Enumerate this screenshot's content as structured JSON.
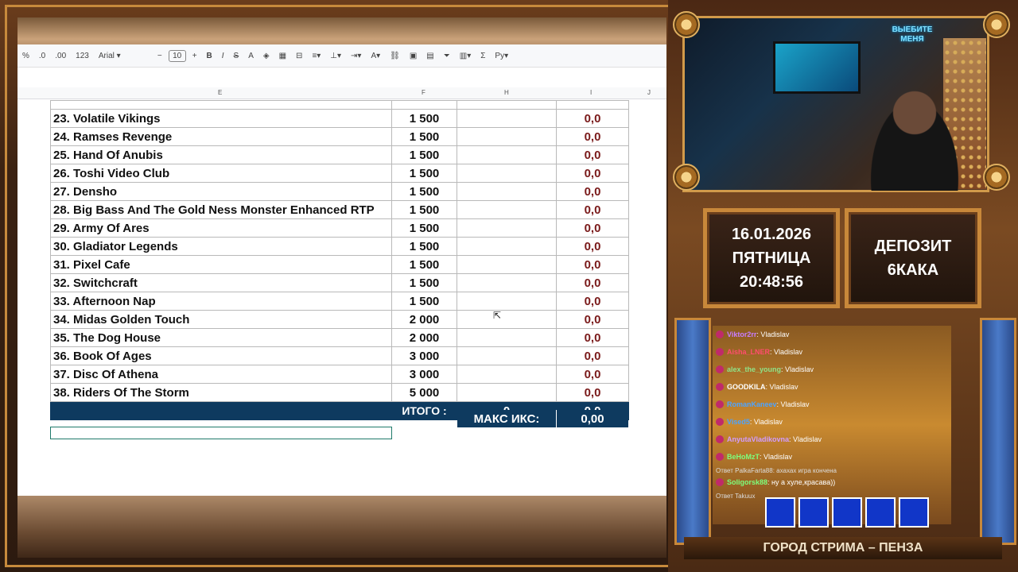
{
  "toolbar": {
    "items": [
      "%",
      ".0",
      ".00",
      "123"
    ],
    "font": "Arial",
    "font_size": "10",
    "minus": "−",
    "plus": "+",
    "bold": "B",
    "italic": "I",
    "strike": "S",
    "text_color": "A",
    "sigma": "Σ",
    "input_tools": "Рy"
  },
  "columns": {
    "e": "E",
    "f": "F",
    "h": "H",
    "i": "I",
    "j": "J"
  },
  "rows": [
    {
      "name": "23. Volatile Vikings",
      "bet": "1 500",
      "result": "0,0"
    },
    {
      "name": "24. Ramses Revenge",
      "bet": "1 500",
      "result": "0,0"
    },
    {
      "name": "25. Hand Of Anubis",
      "bet": "1 500",
      "result": "0,0"
    },
    {
      "name": "26. Toshi Video Club",
      "bet": "1 500",
      "result": "0,0"
    },
    {
      "name": "27. Densho",
      "bet": "1 500",
      "result": "0,0"
    },
    {
      "name": "28. Big Bass And The Gold Ness Monster Enhanced RTP",
      "bet": "1 500",
      "result": "0,0"
    },
    {
      "name": "29. Army Of Ares",
      "bet": "1 500",
      "result": "0,0"
    },
    {
      "name": "30. Gladiator Legends",
      "bet": "1 500",
      "result": "0,0"
    },
    {
      "name": "31. Pixel Cafe",
      "bet": "1 500",
      "result": "0,0"
    },
    {
      "name": "32. Switchcraft",
      "bet": "1 500",
      "result": "0,0"
    },
    {
      "name": "33. Afternoon Nap",
      "bet": "1 500",
      "result": "0,0"
    },
    {
      "name": "34. Midas Golden Touch",
      "bet": "2 000",
      "result": "0,0"
    },
    {
      "name": "35. The Dog House",
      "bet": "2 000",
      "result": "0,0"
    },
    {
      "name": "36. Book Of Ages",
      "bet": "3 000",
      "result": "0,0"
    },
    {
      "name": "37. Disc Of Athena",
      "bet": "3 000",
      "result": "0,0"
    },
    {
      "name": "38. Riders Of The Storm",
      "bet": "5 000",
      "result": "0,0"
    }
  ],
  "total": {
    "label": "ИТОГО :",
    "sum": "0",
    "result": "0,0"
  },
  "max_x": {
    "label": "МАКС ИКС:",
    "value": "0,00"
  },
  "stream": {
    "cam_badge": "ВЫЕБИТЕ МЕНЯ",
    "date": "16.01.2026",
    "weekday": "ПЯТНИЦА",
    "time": "20:48:56",
    "deposit_label": "ДЕПОЗИТ",
    "deposit_value": "6КАКА",
    "footer": "ГОРОД СТРИМА – ПЕНЗА"
  },
  "chat": [
    {
      "user": "Viktor2rr",
      "msg": ": Vladislav",
      "color": "#c77dff"
    },
    {
      "user": "Aisha_LNER",
      "msg": ": Vladislav",
      "color": "#ff4d6d"
    },
    {
      "user": "alex_the_young",
      "msg": ": Vladislav",
      "color": "#8fe388"
    },
    {
      "user": "GOODKILA",
      "msg": ": Vladislav",
      "color": "#ffffff"
    },
    {
      "user": "RomanKaneev",
      "msg": ": Vladislav",
      "color": "#4da3ff"
    },
    {
      "user": "Vised5",
      "msg": ": Vladislav",
      "color": "#4da3ff"
    },
    {
      "user": "AnyutaVladikovna",
      "msg": ": Vladislav",
      "color": "#d29cff"
    },
    {
      "user": "BeHoMzT",
      "msg": ": Vladislav",
      "color": "#7dff7d"
    },
    {
      "user": "Soligorsk88",
      "msg": ": ну а хуле,красава))",
      "color": "#7dff7d"
    }
  ],
  "chat_replies": [
    "Ответ PalkaFarta88: ахахах игра кончена",
    "Ответ Takuux"
  ]
}
